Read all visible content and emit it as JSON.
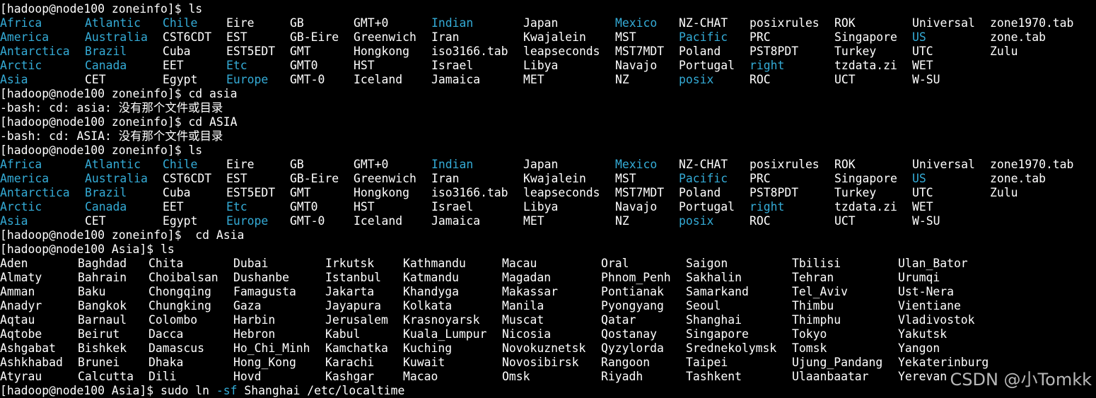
{
  "colors": {
    "background": "#000000",
    "text": "#ffffff",
    "directory": "#34abd6",
    "watermark": "#ebebeb"
  },
  "prompts": {
    "zoneinfo": "[hadoop@node100 zoneinfo]$ ",
    "asia": "[hadoop@node100 Asia]$ "
  },
  "commands": {
    "ls": "ls",
    "cd_lower": "cd asia",
    "cd_upper": "cd ASIA",
    "cd_title": " cd Asia",
    "sudo_prefix": "sudo ln ",
    "sudo_flag": "-sf",
    "sudo_rest": " Shanghai /etc/localtime"
  },
  "errors": {
    "asia": "-bash: cd: asia: 没有那个文件或目录",
    "ASIA": "-bash: cd: ASIA: 没有那个文件或目录"
  },
  "zoneinfo_listing": [
    [
      {
        "t": "Africa",
        "d": true
      },
      {
        "t": "Atlantic",
        "d": true
      },
      {
        "t": "Chile",
        "d": true
      },
      {
        "t": "Eire",
        "d": false
      },
      {
        "t": "GB",
        "d": false
      },
      {
        "t": "GMT+0",
        "d": false
      },
      {
        "t": "Indian",
        "d": true
      },
      {
        "t": "Japan",
        "d": false
      },
      {
        "t": "Mexico",
        "d": true
      },
      {
        "t": "NZ-CHAT",
        "d": false
      },
      {
        "t": "posixrules",
        "d": false
      },
      {
        "t": "ROK",
        "d": false
      },
      {
        "t": "Universal",
        "d": false
      },
      {
        "t": "zone1970.tab",
        "d": false
      }
    ],
    [
      {
        "t": "America",
        "d": true
      },
      {
        "t": "Australia",
        "d": true
      },
      {
        "t": "CST6CDT",
        "d": false
      },
      {
        "t": "EST",
        "d": false
      },
      {
        "t": "GB-Eire",
        "d": false
      },
      {
        "t": "Greenwich",
        "d": false
      },
      {
        "t": "Iran",
        "d": false
      },
      {
        "t": "Kwajalein",
        "d": false
      },
      {
        "t": "MST",
        "d": false
      },
      {
        "t": "Pacific",
        "d": true
      },
      {
        "t": "PRC",
        "d": false
      },
      {
        "t": "Singapore",
        "d": false
      },
      {
        "t": "US",
        "d": true
      },
      {
        "t": "zone.tab",
        "d": false
      }
    ],
    [
      {
        "t": "Antarctica",
        "d": true
      },
      {
        "t": "Brazil",
        "d": true
      },
      {
        "t": "Cuba",
        "d": false
      },
      {
        "t": "EST5EDT",
        "d": false
      },
      {
        "t": "GMT",
        "d": false
      },
      {
        "t": "Hongkong",
        "d": false
      },
      {
        "t": "iso3166.tab",
        "d": false
      },
      {
        "t": "leapseconds",
        "d": false
      },
      {
        "t": "MST7MDT",
        "d": false
      },
      {
        "t": "Poland",
        "d": false
      },
      {
        "t": "PST8PDT",
        "d": false
      },
      {
        "t": "Turkey",
        "d": false
      },
      {
        "t": "UTC",
        "d": false
      },
      {
        "t": "Zulu",
        "d": false
      }
    ],
    [
      {
        "t": "Arctic",
        "d": true
      },
      {
        "t": "Canada",
        "d": true
      },
      {
        "t": "EET",
        "d": false
      },
      {
        "t": "Etc",
        "d": true
      },
      {
        "t": "GMT0",
        "d": false
      },
      {
        "t": "HST",
        "d": false
      },
      {
        "t": "Israel",
        "d": false
      },
      {
        "t": "Libya",
        "d": false
      },
      {
        "t": "Navajo",
        "d": false
      },
      {
        "t": "Portugal",
        "d": false
      },
      {
        "t": "right",
        "d": true
      },
      {
        "t": "tzdata.zi",
        "d": false
      },
      {
        "t": "WET",
        "d": false
      }
    ],
    [
      {
        "t": "Asia",
        "d": true
      },
      {
        "t": "CET",
        "d": false
      },
      {
        "t": "Egypt",
        "d": false
      },
      {
        "t": "Europe",
        "d": true
      },
      {
        "t": "GMT-0",
        "d": false
      },
      {
        "t": "Iceland",
        "d": false
      },
      {
        "t": "Jamaica",
        "d": false
      },
      {
        "t": "MET",
        "d": false
      },
      {
        "t": "NZ",
        "d": false
      },
      {
        "t": "posix",
        "d": true
      },
      {
        "t": "ROC",
        "d": false
      },
      {
        "t": "UCT",
        "d": false
      },
      {
        "t": "W-SU",
        "d": false
      }
    ]
  ],
  "asia_listing": [
    [
      "Aden",
      "Baghdad",
      "Chita",
      "Dubai",
      "Irkutsk",
      "Kathmandu",
      "Macau",
      "Oral",
      "Saigon",
      "Tbilisi",
      "Ulan_Bator"
    ],
    [
      "Almaty",
      "Bahrain",
      "Choibalsan",
      "Dushanbe",
      "Istanbul",
      "Katmandu",
      "Magadan",
      "Phnom_Penh",
      "Sakhalin",
      "Tehran",
      "Urumqi"
    ],
    [
      "Amman",
      "Baku",
      "Chongqing",
      "Famagusta",
      "Jakarta",
      "Khandyga",
      "Makassar",
      "Pontianak",
      "Samarkand",
      "Tel_Aviv",
      "Ust-Nera"
    ],
    [
      "Anadyr",
      "Bangkok",
      "Chungking",
      "Gaza",
      "Jayapura",
      "Kolkata",
      "Manila",
      "Pyongyang",
      "Seoul",
      "Thimbu",
      "Vientiane"
    ],
    [
      "Aqtau",
      "Barnaul",
      "Colombo",
      "Harbin",
      "Jerusalem",
      "Krasnoyarsk",
      "Muscat",
      "Qatar",
      "Shanghai",
      "Thimphu",
      "Vladivostok"
    ],
    [
      "Aqtobe",
      "Beirut",
      "Dacca",
      "Hebron",
      "Kabul",
      "Kuala_Lumpur",
      "Nicosia",
      "Qostanay",
      "Singapore",
      "Tokyo",
      "Yakutsk"
    ],
    [
      "Ashgabat",
      "Bishkek",
      "Damascus",
      "Ho_Chi_Minh",
      "Kamchatka",
      "Kuching",
      "Novokuznetsk",
      "Qyzylorda",
      "Srednekolymsk",
      "Tomsk",
      "Yangon"
    ],
    [
      "Ashkhabad",
      "Brunei",
      "Dhaka",
      "Hong_Kong",
      "Karachi",
      "Kuwait",
      "Novosibirsk",
      "Rangoon",
      "Taipei",
      "Ujung_Pandang",
      "Yekaterinburg"
    ],
    [
      "Atyrau",
      "Calcutta",
      "Dili",
      "Hovd",
      "Kashgar",
      "Macao",
      "Omsk",
      "Riyadh",
      "Tashkent",
      "Ulaanbaatar",
      "Yerevan"
    ]
  ],
  "watermark": "CSDN @小Tomkk"
}
